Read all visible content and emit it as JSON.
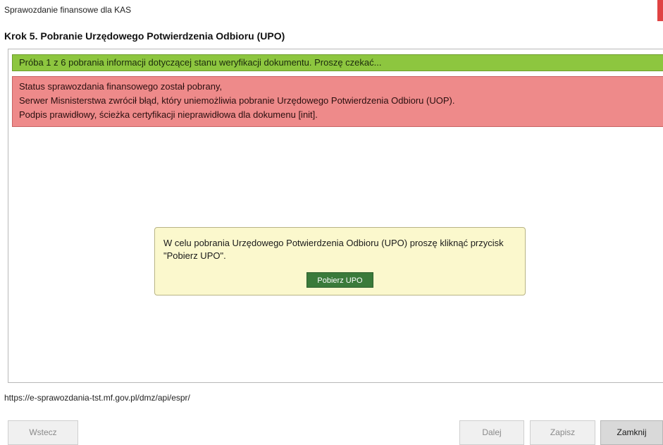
{
  "window": {
    "title": "Sprawozdanie finansowe dla KAS"
  },
  "step": {
    "title": "Krok 5. Pobranie Urzędowego Potwierdzenia Odbioru (UPO)"
  },
  "messages": {
    "progress": "Próba 1 z 6 pobrania informacji dotyczącej stanu weryfikacji dokumentu. Proszę czekać...",
    "error_lines": [
      "Status sprawozdania finansowego został pobrany,",
      "Serwer Misnisterstwa zwrócił błąd, który uniemożliwia pobranie Urzędowego Potwierdzenia Odbioru (UOP).",
      "Podpis prawidłowy, ścieżka certyfikacji nieprawidłowa dla dokumenu [init]."
    ]
  },
  "popup": {
    "text": "W celu pobrania Urzędowego Potwierdzenia Odbioru (UPO) proszę kliknąć przycisk \"Pobierz UPO\".",
    "button_label": "Pobierz UPO"
  },
  "status": {
    "url": "https://e-sprawozdania-tst.mf.gov.pl/dmz/api/espr/"
  },
  "footer": {
    "back_label": "Wstecz",
    "next_label": "Dalej",
    "save_label": "Zapisz",
    "close_label": "Zamknij"
  },
  "colors": {
    "progress_bg": "#8dc63f",
    "error_bg": "#ee8a8a",
    "popup_bg": "#fbf8cd",
    "popup_button_bg": "#3a7a3a",
    "close_accent": "#e04343"
  }
}
